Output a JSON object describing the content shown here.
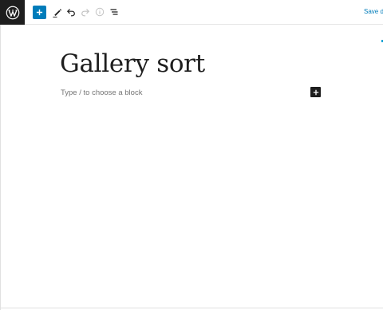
{
  "toolbar": {
    "save_label": "Save draft"
  },
  "editor": {
    "title": "Gallery sort",
    "block_placeholder": "Type / to choose a block"
  },
  "colors": {
    "accent": "#007cba",
    "dark": "#1e1e1e",
    "placeholder": "#757575"
  },
  "icons": {
    "logo": "wordpress-logo-icon",
    "add": "plus-icon",
    "tools": "pencil-icon",
    "undo": "undo-icon",
    "redo": "redo-icon",
    "details": "info-icon",
    "outline": "list-view-icon"
  }
}
